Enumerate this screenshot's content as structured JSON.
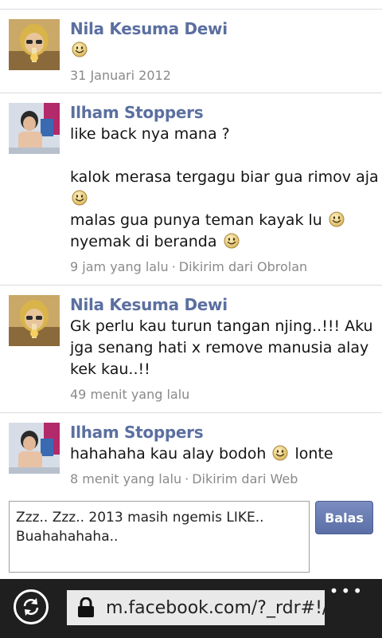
{
  "messages": [
    {
      "sender": "Nila Kesuma Dewi",
      "lines": [
        ""
      ],
      "time": "31 Januari 2012",
      "source": ""
    },
    {
      "sender": "Ilham Stoppers",
      "lines": [
        "like back nya mana ?",
        "kalok merasa tergagu biar gua rimov aja",
        "malas gua punya teman kayak lu",
        "nyemak di beranda"
      ],
      "time": "9 jam yang lalu",
      "source": "Dikirim dari Obrolan"
    },
    {
      "sender": "Nila Kesuma Dewi",
      "lines": [
        "Gk perlu kau turun tangan njing..!!! Aku",
        "jga senang hati x remove manusia alay",
        "kek kau..!!"
      ],
      "time": "49 menit yang lalu",
      "source": ""
    },
    {
      "sender": "Ilham Stoppers",
      "lines": [
        "hahahaha kau alay bodoh",
        "lonte"
      ],
      "time": "8 menit yang lalu",
      "source": "Dikirim dari Web"
    }
  ],
  "meta_separator": "·",
  "reply": {
    "text_line1": "Zzz.. Zzz.. 2013 masih ngemis LIKE..",
    "text_line2": "Buahahahaha..",
    "button_label": "Balas"
  },
  "browser": {
    "url": "m.facebook.com/?_rdr#!/",
    "more_dots": "•••",
    "refresh_icon": "refresh-icon",
    "lock_icon": "lock-icon"
  },
  "colors": {
    "sender_name": "#5b6fa0",
    "accent_button": "#5b6ea6",
    "browser_bar": "#1f1f1f"
  }
}
